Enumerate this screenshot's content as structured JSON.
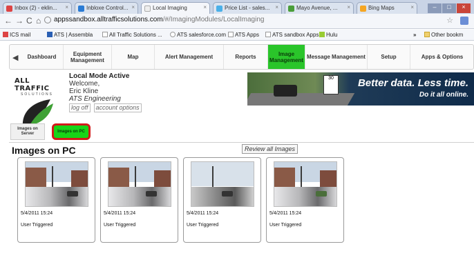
{
  "browser": {
    "tabs": [
      {
        "label": "Inbox (2) - eklin...",
        "color": "#d44"
      },
      {
        "label": "Inbloxe Control...",
        "color": "#2a7bd4"
      },
      {
        "label": "Local Imaging",
        "color": "#eee"
      },
      {
        "label": "Price List - sales...",
        "color": "#4ab0e8"
      },
      {
        "label": "Mayo Avenue, ...",
        "color": "#4a9e3a"
      },
      {
        "label": "Bing Maps",
        "color": "#f5a623"
      }
    ],
    "url_host": "appssandbox.alltrafficsolutions.com",
    "url_path": "/#/ImagingModules/LocalImaging",
    "bookmarks": [
      "ICS mail",
      "ATS | Assembla",
      "All Traffic Solutions ...",
      "ATS salesforce.com",
      "ATS Apps",
      "ATS sandbox Apps",
      "Hulu"
    ],
    "other_bookmarks": "Other bookm"
  },
  "nav": {
    "items": [
      {
        "label": "Dashboard"
      },
      {
        "label": "Equipment Management"
      },
      {
        "label": "Map"
      },
      {
        "label": "Alert Management"
      },
      {
        "label": "Reports"
      },
      {
        "label": "Image Management"
      },
      {
        "label": "Message Management"
      },
      {
        "label": "Setup"
      },
      {
        "label": "Apps & Options"
      }
    ]
  },
  "header": {
    "logo_text": "ALL TRAFFIC",
    "logo_sub": "SOLUTIONS",
    "mode": "Local Mode Active",
    "welcome": "Welcome,",
    "user": "Eric Kline",
    "org": "ATS Engineering",
    "logoff": "log off",
    "account": "account options",
    "banner_line1": "Better data. Less time.",
    "banner_line2": "Do it all online."
  },
  "subtabs": {
    "server": "Images on Server",
    "pc": "Images on PC"
  },
  "section": {
    "title": "Images on PC",
    "review_button": "Review all Images"
  },
  "images": [
    {
      "timestamp": "5/4/2011 15:24",
      "trigger": "User Triggered"
    },
    {
      "timestamp": "5/4/2011 15:24",
      "trigger": "User Triggered"
    },
    {
      "timestamp": "5/4/2011 15:24",
      "trigger": "User Triggered"
    },
    {
      "timestamp": "5/4/2011 15:24",
      "trigger": "User Triggered"
    }
  ]
}
